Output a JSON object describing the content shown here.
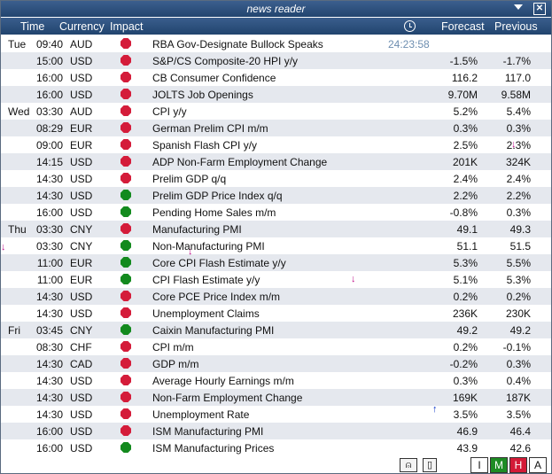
{
  "window": {
    "title": "news reader"
  },
  "header": {
    "time": "Time",
    "currency": "Currency",
    "impact": "Impact",
    "forecast": "Forecast",
    "previous": "Previous"
  },
  "rows": [
    {
      "day": "Tue",
      "time": "09:40",
      "cur": "AUD",
      "impact": "high",
      "event": "RBA Gov-Designate Bullock Speaks",
      "countdown": "24:23:58",
      "forecast": "",
      "previous": ""
    },
    {
      "day": "",
      "time": "15:00",
      "cur": "USD",
      "impact": "high",
      "event": "S&P/CS Composite-20 HPI y/y",
      "countdown": "",
      "forecast": "-1.5%",
      "previous": "-1.7%"
    },
    {
      "day": "",
      "time": "16:00",
      "cur": "USD",
      "impact": "high",
      "event": "CB Consumer Confidence",
      "countdown": "",
      "forecast": "116.2",
      "previous": "117.0"
    },
    {
      "day": "",
      "time": "16:00",
      "cur": "USD",
      "impact": "high",
      "event": "JOLTS Job Openings",
      "countdown": "",
      "forecast": "9.70M",
      "previous": "9.58M"
    },
    {
      "day": "Wed",
      "time": "03:30",
      "cur": "AUD",
      "impact": "high",
      "event": "CPI y/y",
      "countdown": "",
      "forecast": "5.2%",
      "previous": "5.4%"
    },
    {
      "day": "",
      "time": "08:29",
      "cur": "EUR",
      "impact": "high",
      "event": "German Prelim CPI m/m",
      "countdown": "",
      "forecast": "0.3%",
      "previous": "0.3%"
    },
    {
      "day": "",
      "time": "09:00",
      "cur": "EUR",
      "impact": "high",
      "event": "Spanish Flash CPI y/y",
      "countdown": "",
      "forecast": "2.5%",
      "previous": "2.3%"
    },
    {
      "day": "",
      "time": "14:15",
      "cur": "USD",
      "impact": "high",
      "event": "ADP Non-Farm Employment Change",
      "countdown": "",
      "forecast": "201K",
      "previous": "324K"
    },
    {
      "day": "",
      "time": "14:30",
      "cur": "USD",
      "impact": "high",
      "event": "Prelim GDP q/q",
      "countdown": "",
      "forecast": "2.4%",
      "previous": "2.4%"
    },
    {
      "day": "",
      "time": "14:30",
      "cur": "USD",
      "impact": "medium",
      "event": "Prelim GDP Price Index q/q",
      "countdown": "",
      "forecast": "2.2%",
      "previous": "2.2%"
    },
    {
      "day": "",
      "time": "16:00",
      "cur": "USD",
      "impact": "medium",
      "event": "Pending Home Sales m/m",
      "countdown": "",
      "forecast": "-0.8%",
      "previous": "0.3%"
    },
    {
      "day": "Thu",
      "time": "03:30",
      "cur": "CNY",
      "impact": "high",
      "event": "Manufacturing PMI",
      "countdown": "",
      "forecast": "49.1",
      "previous": "49.3"
    },
    {
      "day": "",
      "time": "03:30",
      "cur": "CNY",
      "impact": "medium",
      "event": "Non-Manufacturing PMI",
      "countdown": "",
      "forecast": "51.1",
      "previous": "51.5"
    },
    {
      "day": "",
      "time": "11:00",
      "cur": "EUR",
      "impact": "medium",
      "event": "Core CPI Flash Estimate y/y",
      "countdown": "",
      "forecast": "5.3%",
      "previous": "5.5%"
    },
    {
      "day": "",
      "time": "11:00",
      "cur": "EUR",
      "impact": "medium",
      "event": "CPI Flash Estimate y/y",
      "countdown": "",
      "forecast": "5.1%",
      "previous": "5.3%"
    },
    {
      "day": "",
      "time": "14:30",
      "cur": "USD",
      "impact": "high",
      "event": "Core PCE Price Index m/m",
      "countdown": "",
      "forecast": "0.2%",
      "previous": "0.2%"
    },
    {
      "day": "",
      "time": "14:30",
      "cur": "USD",
      "impact": "high",
      "event": "Unemployment Claims",
      "countdown": "",
      "forecast": "236K",
      "previous": "230K"
    },
    {
      "day": "Fri",
      "time": "03:45",
      "cur": "CNY",
      "impact": "medium",
      "event": "Caixin Manufacturing PMI",
      "countdown": "",
      "forecast": "49.2",
      "previous": "49.2"
    },
    {
      "day": "",
      "time": "08:30",
      "cur": "CHF",
      "impact": "high",
      "event": "CPI m/m",
      "countdown": "",
      "forecast": "0.2%",
      "previous": "-0.1%"
    },
    {
      "day": "",
      "time": "14:30",
      "cur": "CAD",
      "impact": "high",
      "event": "GDP m/m",
      "countdown": "",
      "forecast": "-0.2%",
      "previous": "0.3%"
    },
    {
      "day": "",
      "time": "14:30",
      "cur": "USD",
      "impact": "high",
      "event": "Average Hourly Earnings m/m",
      "countdown": "",
      "forecast": "0.3%",
      "previous": "0.4%"
    },
    {
      "day": "",
      "time": "14:30",
      "cur": "USD",
      "impact": "high",
      "event": "Non-Farm Employment Change",
      "countdown": "",
      "forecast": "169K",
      "previous": "187K"
    },
    {
      "day": "",
      "time": "14:30",
      "cur": "USD",
      "impact": "high",
      "event": "Unemployment Rate",
      "countdown": "",
      "forecast": "3.5%",
      "previous": "3.5%"
    },
    {
      "day": "",
      "time": "16:00",
      "cur": "USD",
      "impact": "high",
      "event": "ISM Manufacturing PMI",
      "countdown": "",
      "forecast": "46.9",
      "previous": "46.4"
    },
    {
      "day": "",
      "time": "16:00",
      "cur": "USD",
      "impact": "medium",
      "event": "ISM Manufacturing Prices",
      "countdown": "",
      "forecast": "43.9",
      "previous": "42.6"
    }
  ],
  "footer": {
    "filter_i": "I",
    "filter_m": "M",
    "filter_h": "H",
    "filter_a": "A"
  },
  "colors": {
    "high": "#d41c3a",
    "medium": "#138a1e",
    "countdown": "#6d8eb0",
    "header": "#2b4f7c"
  }
}
